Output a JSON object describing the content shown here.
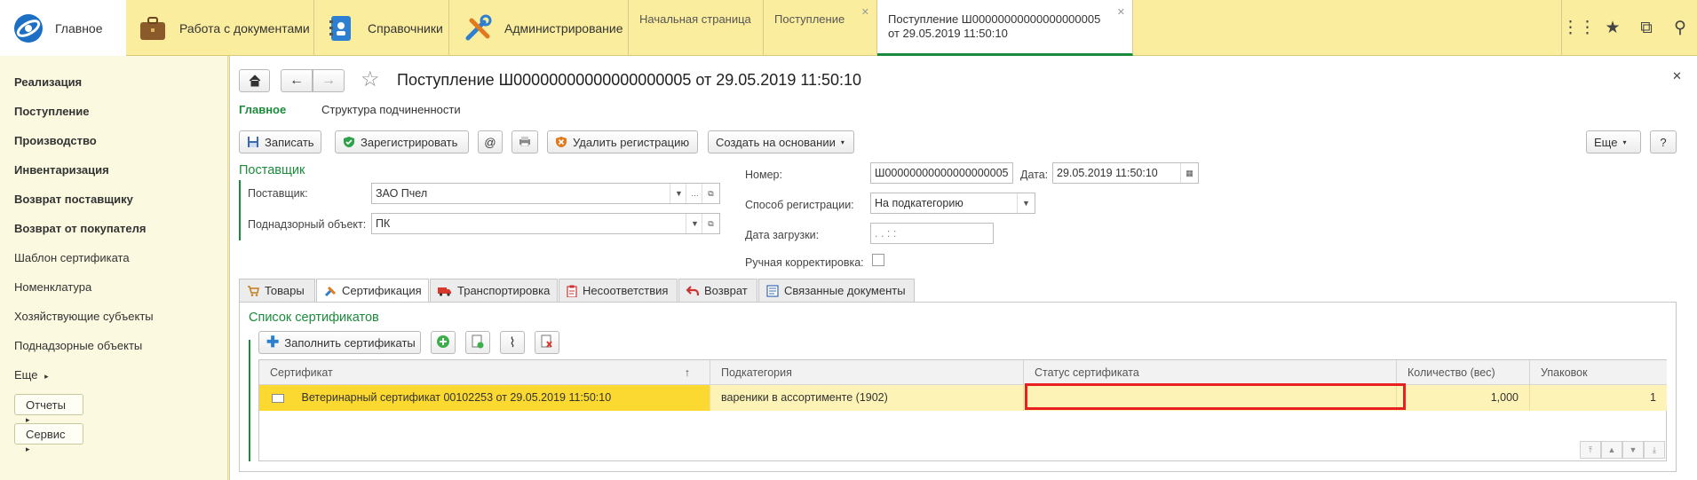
{
  "colors": {
    "accent": "#1b8b3b",
    "topbar": "#fbed9e",
    "sidebar": "#fbf9e0",
    "selected_row": "#fbd930",
    "highlight": "#e8201f"
  },
  "sections": [
    {
      "label": "Главное",
      "icon": "logo-icon"
    },
    {
      "label": "Работа с документами",
      "icon": "briefcase-icon"
    },
    {
      "label": "Справочники",
      "icon": "address-book-icon"
    },
    {
      "label": "Администрирование",
      "icon": "tools-icon"
    }
  ],
  "open_tabs": [
    {
      "label": "Начальная страница"
    },
    {
      "label": "Поступление"
    },
    {
      "label": "Поступление Ш00000000000000000005 от 29.05.2019 11:50:10"
    }
  ],
  "sidebar": {
    "items": [
      "Реализация",
      "Поступление",
      "Производство",
      "Инвентаризация",
      "Возврат поставщику",
      "Возврат от покупателя",
      "Шаблон сертификата",
      "Номенклатура",
      "Хозяйствующие субъекты",
      "Поднадзорные объекты",
      "Еще"
    ],
    "buttons": [
      "Отчеты",
      "Сервис"
    ]
  },
  "document": {
    "title": "Поступление Ш00000000000000000005 от 29.05.2019 11:50:10",
    "nav_main": "Главное",
    "nav_structure": "Структура подчиненности",
    "toolbar": {
      "save": "Записать",
      "register": "Зарегистрировать",
      "email": "@",
      "delete_registration": "Удалить регистрацию",
      "create_based": "Создать на основании",
      "more": "Еще",
      "help": "?"
    },
    "supplier_group": "Поставщик",
    "supplier_label": "Поставщик:",
    "supplier_value": "ЗАО Пчел",
    "object_label": "Поднадзорный объект:",
    "object_value": "ПК",
    "number_label": "Номер:",
    "number_value": "Ш00000000000000000005",
    "date_label": "Дата:",
    "date_value": "29.05.2019 11:50:10",
    "reg_method_label": "Способ регистрации:",
    "reg_method_value": "На подкатегорию",
    "load_date_label": "Дата загрузки:",
    "load_date_value": " .  .      :  :",
    "manual_label": "Ручная корректировка:"
  },
  "tabs": [
    {
      "label": "Товары",
      "icon": "cart-icon"
    },
    {
      "label": "Сертификация",
      "icon": "certificate-icon"
    },
    {
      "label": "Транспортировка",
      "icon": "truck-icon"
    },
    {
      "label": "Несоответствия",
      "icon": "clipboard-icon"
    },
    {
      "label": "Возврат",
      "icon": "return-arrow-icon"
    },
    {
      "label": "Связанные документы",
      "icon": "linked-docs-icon"
    }
  ],
  "certificates": {
    "title": "Список сертификатов",
    "fill_button": "Заполнить сертификаты",
    "columns": [
      "Сертификат",
      "Подкатегория",
      "Статус сертификата",
      "Количество (вес)",
      "Упаковок"
    ],
    "sort_indicator": "↑",
    "rows": [
      {
        "certificate": "Ветеринарный сертификат 00102253 от 29.05.2019 11:50:10",
        "subcategory": "вареники в ассортименте (1902)",
        "status": "",
        "quantity": "1,000",
        "packages": "1"
      }
    ]
  }
}
